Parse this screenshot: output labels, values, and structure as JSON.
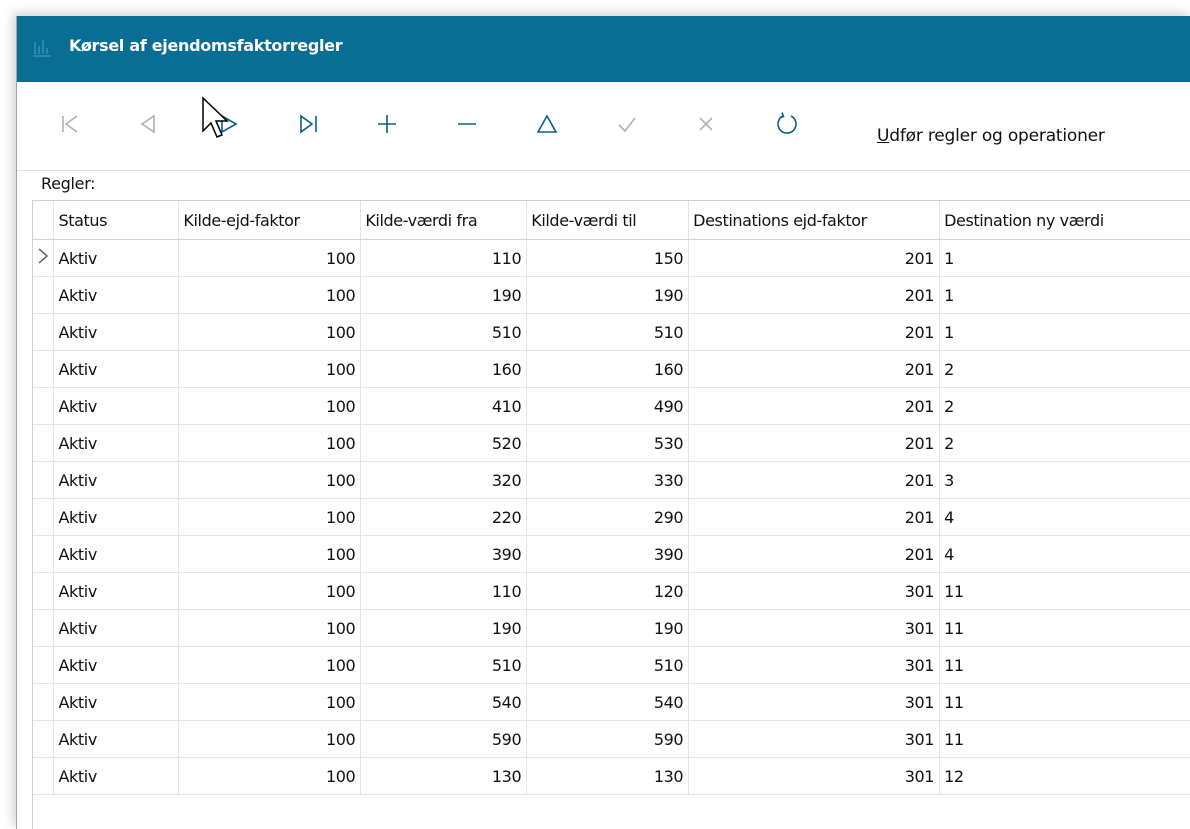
{
  "window": {
    "title": "Kørsel af ejendomsfaktorregler"
  },
  "toolbar": {
    "buttons": [
      {
        "name": "first-record",
        "icon": "first-record-icon"
      },
      {
        "name": "previous-record",
        "icon": "previous-record-icon"
      },
      {
        "name": "next-record",
        "icon": "next-record-icon"
      },
      {
        "name": "last-record",
        "icon": "last-record-icon"
      },
      {
        "name": "add-record",
        "icon": "plus-icon"
      },
      {
        "name": "delete-record",
        "icon": "minus-icon"
      },
      {
        "name": "edit-record",
        "icon": "triangle-icon"
      },
      {
        "name": "save-record",
        "icon": "checkmark-icon"
      },
      {
        "name": "cancel-edit",
        "icon": "close-icon"
      },
      {
        "name": "refresh",
        "icon": "refresh-icon"
      }
    ],
    "action_label_underlined": "U",
    "action_label_rest": "dfør regler og operationer"
  },
  "section_label": "Regler:",
  "table": {
    "columns": [
      "Status",
      "Kilde-ejd-faktor",
      "Kilde-værdi fra",
      "Kilde-værdi til",
      "Destinations ejd-faktor",
      "Destination ny værdi"
    ],
    "rows": [
      [
        "Aktiv",
        "100",
        "110",
        "150",
        "201",
        "1"
      ],
      [
        "Aktiv",
        "100",
        "190",
        "190",
        "201",
        "1"
      ],
      [
        "Aktiv",
        "100",
        "510",
        "510",
        "201",
        "1"
      ],
      [
        "Aktiv",
        "100",
        "160",
        "160",
        "201",
        "2"
      ],
      [
        "Aktiv",
        "100",
        "410",
        "490",
        "201",
        "2"
      ],
      [
        "Aktiv",
        "100",
        "520",
        "530",
        "201",
        "2"
      ],
      [
        "Aktiv",
        "100",
        "320",
        "330",
        "201",
        "3"
      ],
      [
        "Aktiv",
        "100",
        "220",
        "290",
        "201",
        "4"
      ],
      [
        "Aktiv",
        "100",
        "390",
        "390",
        "201",
        "4"
      ],
      [
        "Aktiv",
        "100",
        "110",
        "120",
        "301",
        "11"
      ],
      [
        "Aktiv",
        "100",
        "190",
        "190",
        "301",
        "11"
      ],
      [
        "Aktiv",
        "100",
        "510",
        "510",
        "301",
        "11"
      ],
      [
        "Aktiv",
        "100",
        "540",
        "540",
        "301",
        "11"
      ],
      [
        "Aktiv",
        "100",
        "590",
        "590",
        "301",
        "11"
      ],
      [
        "Aktiv",
        "100",
        "130",
        "130",
        "301",
        "12"
      ]
    ],
    "current_row_indicator": "row-indicator-chevron-icon"
  },
  "colors": {
    "titlebar": "#0a6e94",
    "title_text": "#ffffff",
    "icon_disabled": "#a9b3bc",
    "icon_enabled": "#0b5f86"
  }
}
